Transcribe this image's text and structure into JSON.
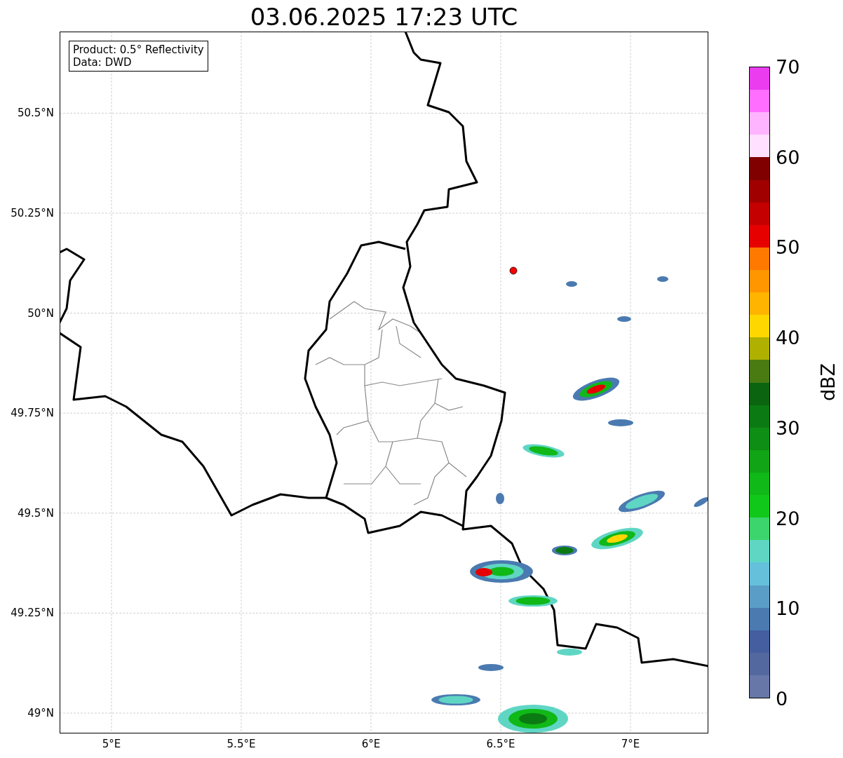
{
  "title": "03.06.2025 17:23 UTC",
  "info_box": [
    "Product: 0.5° Reflectivity",
    "Data: DWD"
  ],
  "y_ticks": [
    "50.5°N",
    "50.25°N",
    "50°N",
    "49.75°N",
    "49.5°N",
    "49.25°N",
    "49°N"
  ],
  "x_ticks": [
    "5°E",
    "5.5°E",
    "6°E",
    "6.5°E",
    "7°E"
  ],
  "colorbar": {
    "label": "dBZ",
    "ticks": [
      "70",
      "60",
      "50",
      "40",
      "30",
      "20",
      "10",
      "0"
    ],
    "segments": [
      {
        "color": "#eb3cf0"
      },
      {
        "color": "#ff6eff"
      },
      {
        "color": "#ffb4ff"
      },
      {
        "color": "#ffe0ff"
      },
      {
        "color": "#800000"
      },
      {
        "color": "#a00000"
      },
      {
        "color": "#c40000"
      },
      {
        "color": "#e60000"
      },
      {
        "color": "#ff7800"
      },
      {
        "color": "#ff9600"
      },
      {
        "color": "#ffb400"
      },
      {
        "color": "#ffd700"
      },
      {
        "color": "#b0b000"
      },
      {
        "color": "#4a7a12"
      },
      {
        "color": "#0a6410"
      },
      {
        "color": "#0c7a12"
      },
      {
        "color": "#0e8e14"
      },
      {
        "color": "#10a416"
      },
      {
        "color": "#10b818"
      },
      {
        "color": "#10c81a"
      },
      {
        "color": "#3cd46c"
      },
      {
        "color": "#5fd6c4"
      },
      {
        "color": "#64c0db"
      },
      {
        "color": "#5a9dc6"
      },
      {
        "color": "#4a7ab0"
      },
      {
        "color": "#445ea0"
      },
      {
        "color": "#5468a0"
      },
      {
        "color": "#6677a8"
      }
    ]
  }
}
